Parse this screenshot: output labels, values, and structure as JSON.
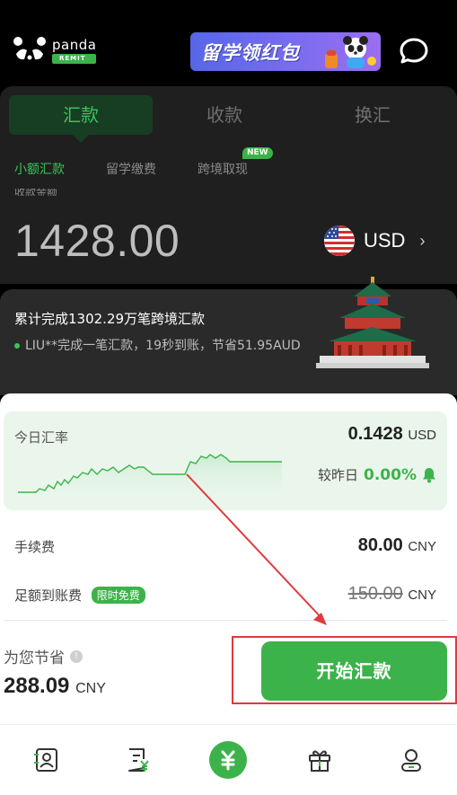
{
  "header": {
    "logo_word": "panda",
    "logo_tag": "REMIT",
    "banner_text": "留学领红包"
  },
  "main_tabs": [
    {
      "label": "汇款",
      "active": true
    },
    {
      "label": "收款",
      "active": false
    },
    {
      "label": "换汇",
      "active": false
    }
  ],
  "sub_tabs": [
    {
      "label": "小额汇款",
      "active": true
    },
    {
      "label": "留学缴费",
      "active": false
    },
    {
      "label": "跨境取现",
      "active": false,
      "badge": "NEW"
    }
  ],
  "amount_section": {
    "label_cut": "收款金额",
    "amount": "1428.00",
    "currency": "USD"
  },
  "info_strip": {
    "title": "累计完成1302.29万笔跨境汇款",
    "line": "LIU**完成一笔汇款，19秒到账，节省51.95AUD"
  },
  "rate": {
    "label": "今日汇率",
    "value": "0.1428",
    "unit": "USD",
    "compare_label": "较昨日",
    "compare_pct": "0.00%"
  },
  "fees": {
    "fee_label": "手续费",
    "fee_value": "80.00",
    "fee_unit": "CNY",
    "full_label": "足额到账费",
    "free_badge": "限时免费",
    "full_value": "150.00",
    "full_unit": "CNY"
  },
  "savings": {
    "label": "为您节省",
    "value": "288.09",
    "unit": "CNY"
  },
  "cta": {
    "label": "开始汇款"
  },
  "colors": {
    "accent": "#3cb34a",
    "annotation": "#e0393e"
  },
  "icons": {
    "nav": [
      "contact-book-icon",
      "bill-yuan-icon",
      "yuan-remit-icon",
      "gift-icon",
      "user-icon"
    ]
  }
}
